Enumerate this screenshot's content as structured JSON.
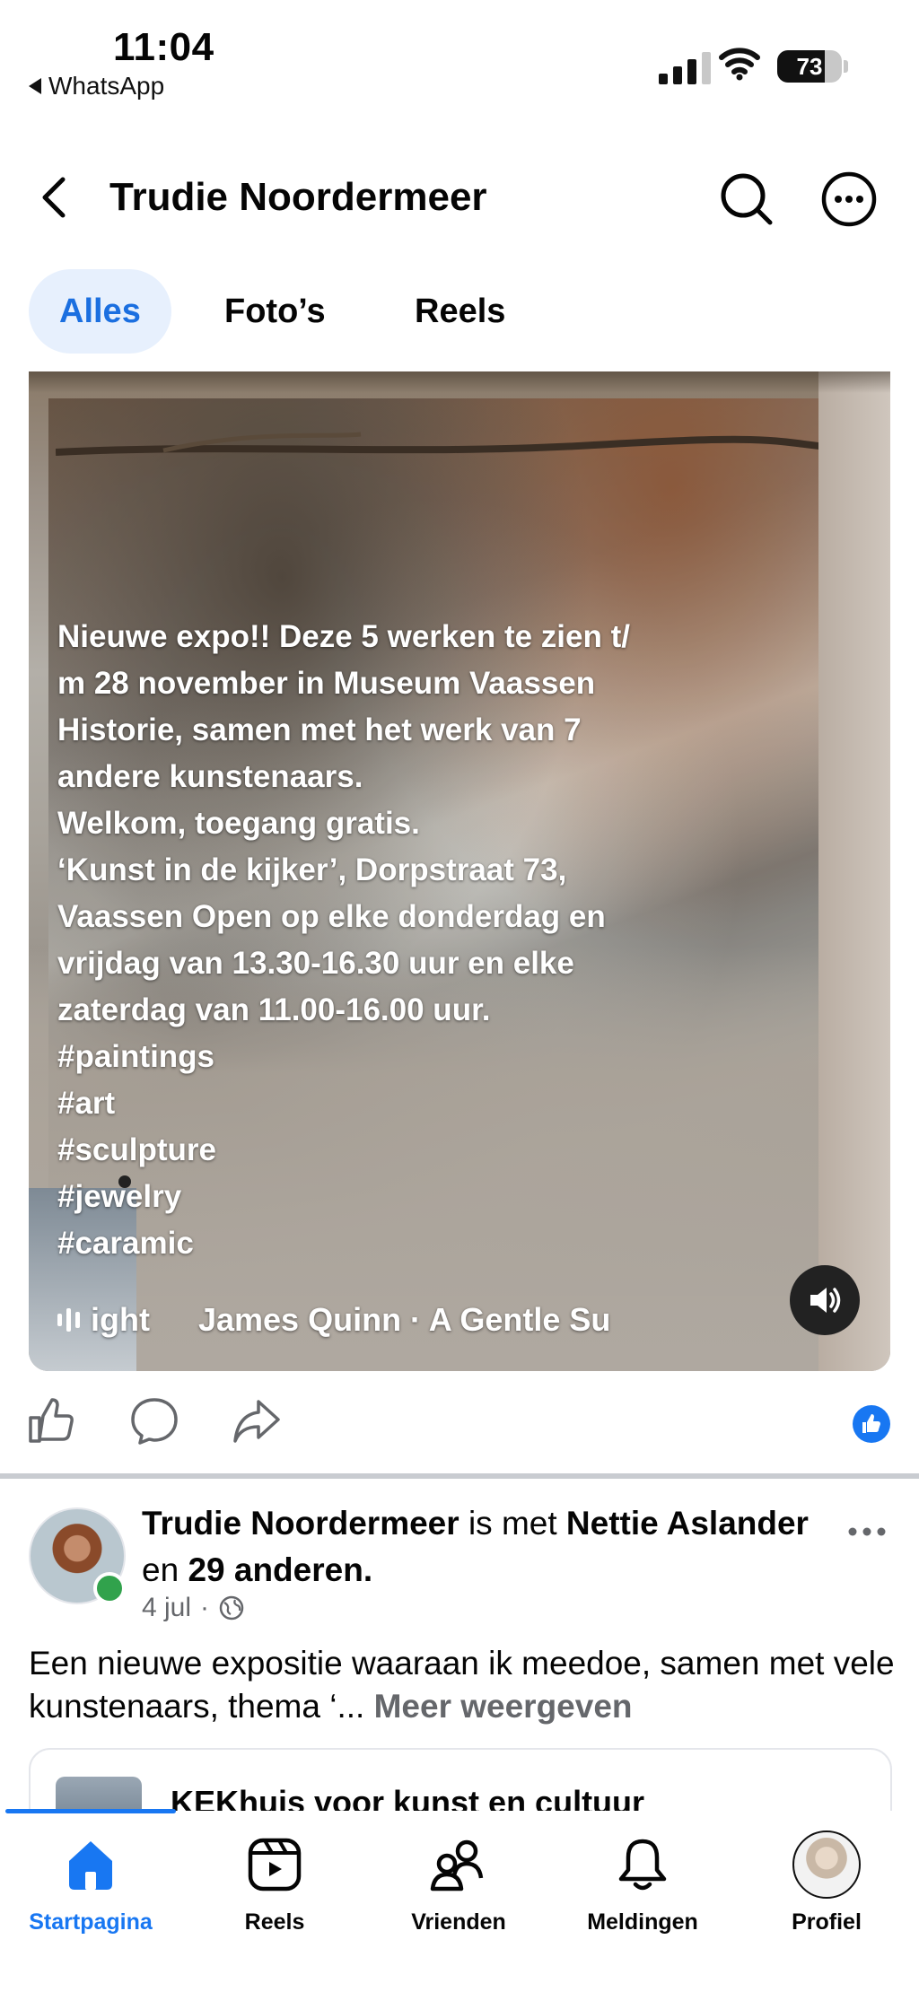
{
  "status_bar": {
    "time": "11:04",
    "back_app": "WhatsApp",
    "battery_percent": "73",
    "battery_level": 0.73
  },
  "header": {
    "title": "Trudie Noordermeer"
  },
  "tabs": [
    {
      "label": "Alles",
      "active": true
    },
    {
      "label": "Foto’s",
      "active": false
    },
    {
      "label": "Reels",
      "active": false
    }
  ],
  "media": {
    "caption": "Nieuwe expo!! Deze 5 werken te zien t/\nm 28 november in Museum Vaassen\nHistorie, samen met het werk van 7\nandere kunstenaars.\nWelkom, toegang gratis.\n‘Kunst in de kijker’, Dorpstraat 73,\nVaassen Open op elke donderdag en\nvrijdag van 13.30-16.30 uur en elke\nzaterdag van 11.00-16.00 uur.\n#paintings\n#art\n#sculpture\n#jewelry\n#caramic",
    "music_left": "ight",
    "music_track": "James Quinn · A Gentle Su"
  },
  "post": {
    "author": "Trudie Noordermeer",
    "with_text": "is met",
    "tagged": "Nettie Aslander",
    "and_text": "en",
    "others": "29 anderen",
    "date": "4 jul",
    "text": "Een nieuwe expositie waaraan ik meedoe, samen met vele kunstenaars, thema ‘...",
    "more_label": "Meer weergeven",
    "link_title": "KEKhuis voor kunst en cultuur"
  },
  "bottom_nav": [
    {
      "label": "Startpagina",
      "icon": "home-icon",
      "active": true
    },
    {
      "label": "Reels",
      "icon": "reels-icon",
      "active": false
    },
    {
      "label": "Vrienden",
      "icon": "friends-icon",
      "active": false
    },
    {
      "label": "Meldingen",
      "icon": "bell-icon",
      "active": false
    },
    {
      "label": "Profiel",
      "icon": "profile-avatar",
      "active": false
    }
  ],
  "colors": {
    "accent": "#1877f2",
    "tab_active_bg": "#e7f0fd",
    "online": "#31a24c",
    "muted_text": "#65676b"
  }
}
